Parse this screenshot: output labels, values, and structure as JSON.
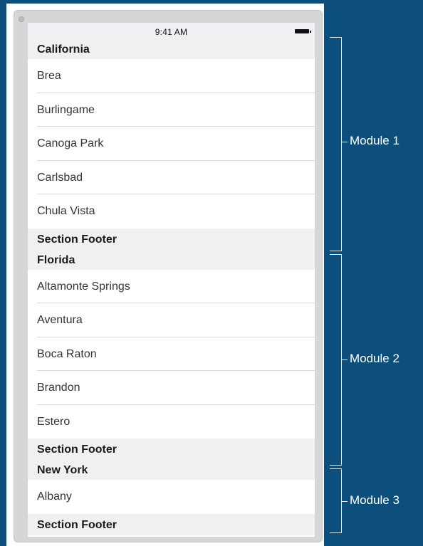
{
  "status_bar": {
    "time": "9:41 AM"
  },
  "sections": [
    {
      "header": "California",
      "rows": [
        "Brea",
        "Burlingame",
        "Canoga Park",
        "Carlsbad",
        "Chula Vista"
      ],
      "footer": "Section Footer"
    },
    {
      "header": "Florida",
      "rows": [
        "Altamonte Springs",
        "Aventura",
        "Boca Raton",
        "Brandon",
        "Estero"
      ],
      "footer": "Section Footer"
    },
    {
      "header": "New York",
      "rows": [
        "Albany"
      ],
      "footer": "Section Footer"
    }
  ],
  "modules": [
    "Module 1",
    "Module 2",
    "Module 3"
  ],
  "colors": {
    "background": "#0d4f7c",
    "section_background": "#f0f0f0",
    "bracket": "#e8e8e8",
    "label": "#ffffff"
  }
}
